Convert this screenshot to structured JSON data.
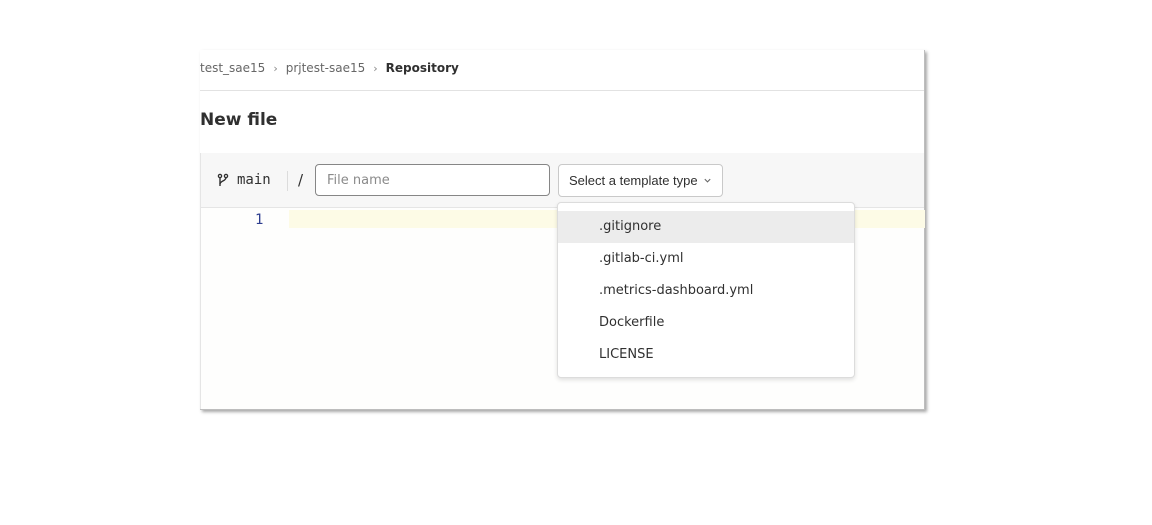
{
  "breadcrumb": {
    "group": "test_sae15",
    "project": "prjtest-sae15",
    "current": "Repository"
  },
  "page": {
    "title": "New file"
  },
  "editor": {
    "branch": "main",
    "path_separator": "/",
    "file_name_placeholder": "File name",
    "file_name_value": "",
    "template_button_label": "Select a template type",
    "line_numbers": [
      "1"
    ]
  },
  "template_dropdown": {
    "items": [
      {
        "label": ".gitignore",
        "highlighted": true
      },
      {
        "label": ".gitlab-ci.yml",
        "highlighted": false
      },
      {
        "label": ".metrics-dashboard.yml",
        "highlighted": false
      },
      {
        "label": "Dockerfile",
        "highlighted": false
      },
      {
        "label": "LICENSE",
        "highlighted": false
      }
    ]
  },
  "icons": {
    "branch": "git-branch-icon",
    "breadcrumb_separator": "chevron-right-icon",
    "dropdown_toggle": "chevron-down-icon"
  },
  "colors": {
    "line_number": "#2e3e8f",
    "active_line": "#fdfbe6",
    "highlighted_item": "#ececec"
  }
}
